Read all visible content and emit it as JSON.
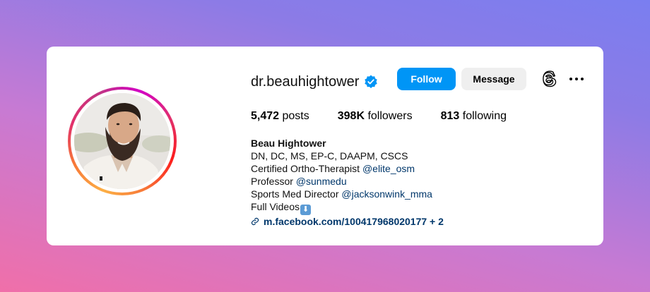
{
  "profile": {
    "username": "dr.beauhightower",
    "follow_label": "Follow",
    "message_label": "Message",
    "stats": {
      "posts_count": "5,472",
      "posts_label": "posts",
      "followers_count": "398K",
      "followers_label": "followers",
      "following_count": "813",
      "following_label": "following"
    },
    "bio": {
      "name": "Beau Hightower",
      "credentials": "DN, DC, MS, EP-C, DAAPM, CSCS",
      "line1_text": "Certified Ortho-Therapist ",
      "line1_mention": "@elite_osm",
      "line2_text": "Professor ",
      "line2_mention": "@sunmedu",
      "line3_text": "Sports Med Director ",
      "line3_mention": "@jacksonwink_mma",
      "line4_text": "Full Videos",
      "line4_emoji": "⬇",
      "link": "m.facebook.com/100417968020177 + 2"
    }
  },
  "colors": {
    "accent": "#0095f6",
    "mention": "#00376b",
    "verified": "#0095f6"
  },
  "icons": [
    "verified-badge-icon",
    "threads-icon",
    "more-options-icon",
    "link-icon",
    "down-arrow-emoji"
  ]
}
